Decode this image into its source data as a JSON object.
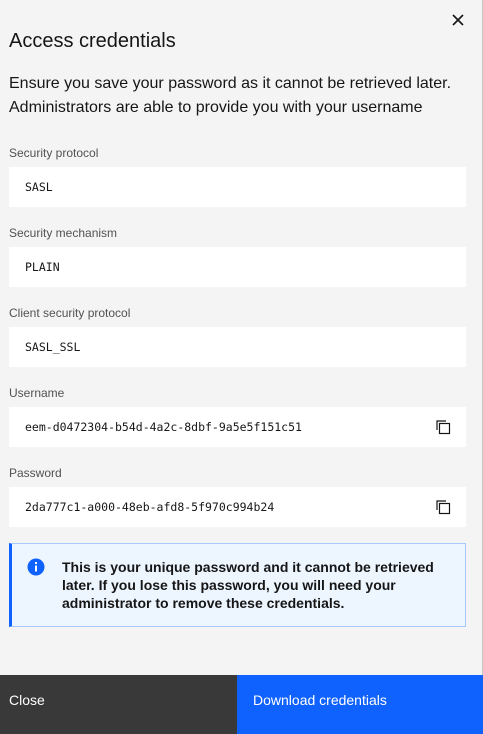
{
  "modal": {
    "title": "Access credentials",
    "description": "Ensure you save your password as it cannot be retrieved later. Administrators are able to provide you with your username",
    "close_icon": "close-icon"
  },
  "fields": {
    "security_protocol": {
      "label": "Security protocol",
      "value": "SASL"
    },
    "security_mechanism": {
      "label": "Security mechanism",
      "value": "PLAIN"
    },
    "client_security_protocol": {
      "label": "Client security protocol",
      "value": "SASL_SSL"
    },
    "username": {
      "label": "Username",
      "value": "eem-d0472304-b54d-4a2c-8dbf-9a5e5f151c51",
      "icon": "copy-icon"
    },
    "password": {
      "label": "Password",
      "value": "2da777c1-a000-48eb-afd8-5f970c994b24",
      "icon": "copy-icon"
    }
  },
  "notice": {
    "icon": "information-icon",
    "text": "This is your unique password and it cannot be retrieved later. If you lose this password, you will need your administrator to remove these credentials."
  },
  "footer": {
    "close_label": "Close",
    "download_label": "Download credentials"
  },
  "colors": {
    "primary": "#0f62fe",
    "secondary": "#393939",
    "background": "#f4f4f4",
    "field_background": "#ffffff",
    "notice_background": "#edf5ff"
  }
}
